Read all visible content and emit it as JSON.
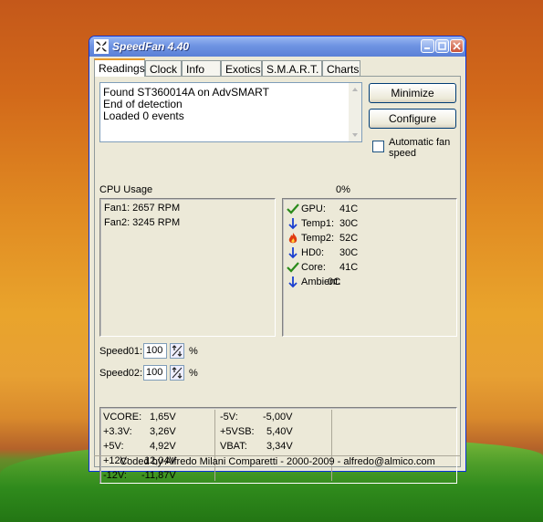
{
  "window": {
    "title": "SpeedFan 4.40"
  },
  "tabs": [
    "Readings",
    "Clock",
    "Info",
    "Exotics",
    "S.M.A.R.T.",
    "Charts"
  ],
  "log": [
    "Found ST360014A on AdvSMART",
    "End of detection",
    "Loaded 0 events"
  ],
  "buttons": {
    "minimize": "Minimize",
    "configure": "Configure"
  },
  "auto_fan": {
    "label": "Automatic fan speed",
    "checked": false
  },
  "cpu_usage": {
    "label": "CPU Usage",
    "value": "0%"
  },
  "fans": [
    "Fan1: 2657 RPM",
    "Fan2: 3245 RPM"
  ],
  "temps": [
    {
      "name": "GPU:",
      "value": "41C",
      "icon": "check-icon",
      "color": "#2a8a1a"
    },
    {
      "name": "Temp1:",
      "value": "30C",
      "icon": "arrow-down-icon",
      "color": "#1a3fd0"
    },
    {
      "name": "Temp2:",
      "value": "52C",
      "icon": "flame-icon",
      "color": "#e03a10"
    },
    {
      "name": "HD0:",
      "value": "30C",
      "icon": "arrow-down-icon",
      "color": "#1a3fd0"
    },
    {
      "name": "Core:",
      "value": "41C",
      "icon": "check-icon",
      "color": "#2a8a1a"
    },
    {
      "name": "Ambient:",
      "value": "0C",
      "icon": "arrow-down-icon",
      "color": "#1a3fd0"
    }
  ],
  "speeds": [
    {
      "label": "Speed01:",
      "value": "100",
      "unit": "%"
    },
    {
      "label": "Speed02:",
      "value": "100",
      "unit": "%"
    }
  ],
  "voltages_left": [
    {
      "name": "VCORE:",
      "value": "1,65V"
    },
    {
      "name": "+3.3V:",
      "value": "3,26V"
    },
    {
      "name": "+5V:",
      "value": "4,92V"
    },
    {
      "name": "+12V:",
      "value": "12,04V"
    },
    {
      "name": "-12V:",
      "value": "-11,87V"
    }
  ],
  "voltages_right": [
    {
      "name": "-5V:",
      "value": "-5,00V"
    },
    {
      "name": "+5VSB:",
      "value": "5,40V"
    },
    {
      "name": "VBAT:",
      "value": "3,34V"
    }
  ],
  "footer": "Coded by Alfredo Milani Comparetti - 2000-2009 - alfredo@almico.com"
}
